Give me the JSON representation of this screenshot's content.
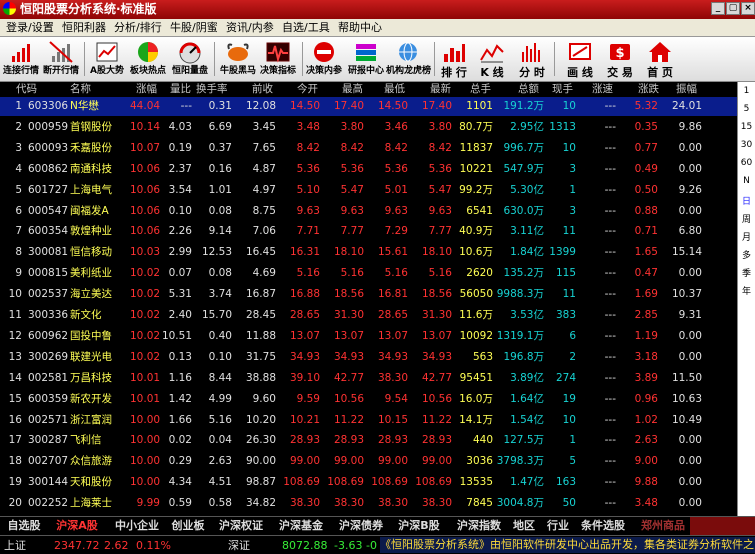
{
  "window": {
    "title": "恒阳股票分析系统·标准版",
    "min_label": "_",
    "max_label": "▢",
    "close_label": "×"
  },
  "menu": [
    "登录/设置",
    "恒阳利器",
    "分析/排行",
    "牛股/阴蜜",
    "资讯/内参",
    "自选/工具",
    "帮助中心"
  ],
  "toolbar": [
    {
      "label": "连接行情",
      "icon": "signal-icon"
    },
    {
      "label": "断开行情",
      "icon": "disconnect-icon"
    },
    {
      "label": "A股大势",
      "icon": "book-chart-icon"
    },
    {
      "label": "板块热点",
      "icon": "pie-chart-icon"
    },
    {
      "label": "恒阳量盘",
      "icon": "gauge-icon"
    },
    {
      "label": "牛股黑马",
      "icon": "bull-icon"
    },
    {
      "label": "决策指标",
      "icon": "heartbeat-icon"
    },
    {
      "label": "决策内参",
      "icon": "no-entry-icon"
    },
    {
      "label": "研报中心",
      "icon": "stacked-books-icon"
    },
    {
      "label": "机构龙虎榜",
      "icon": "globe-people-icon"
    },
    {
      "label": "排 行",
      "icon": "bar-ranking-icon"
    },
    {
      "label": "K 线",
      "icon": "k-line-icon"
    },
    {
      "label": "分 时",
      "icon": "tick-bars-icon"
    },
    {
      "label": "画 线",
      "icon": "draw-line-icon"
    },
    {
      "label": "交 易",
      "icon": "trade-icon"
    },
    {
      "label": "首 页",
      "icon": "home-icon"
    }
  ],
  "table": {
    "columns": [
      "",
      "代码",
      "名称",
      "涨幅",
      "量比",
      "换手率",
      "前收",
      "今开",
      "最高",
      "最低",
      "最新",
      "总手",
      "总额",
      "现手",
      "涨速",
      "涨跌",
      "振幅"
    ],
    "rows": [
      [
        "1",
        "603306",
        "N华懋",
        "44.04",
        "---",
        "0.31",
        "12.08",
        "14.50",
        "17.40",
        "14.50",
        "17.40",
        "1101",
        "191.2万",
        "10",
        "---",
        "5.32",
        "24.01"
      ],
      [
        "2",
        "000959",
        "首钢股份",
        "10.14",
        "4.03",
        "6.69",
        "3.45",
        "3.48",
        "3.80",
        "3.46",
        "3.80",
        "80.7万",
        "2.95亿",
        "1313",
        "---",
        "0.35",
        "9.86"
      ],
      [
        "3",
        "600093",
        "禾嘉股份",
        "10.07",
        "0.19",
        "0.37",
        "7.65",
        "8.42",
        "8.42",
        "8.42",
        "8.42",
        "11837",
        "996.7万",
        "10",
        "---",
        "0.77",
        "0.00"
      ],
      [
        "4",
        "600862",
        "南通科技",
        "10.06",
        "2.37",
        "0.16",
        "4.87",
        "5.36",
        "5.36",
        "5.36",
        "5.36",
        "10221",
        "547.9万",
        "3",
        "---",
        "0.49",
        "0.00"
      ],
      [
        "5",
        "601727",
        "上海电气",
        "10.06",
        "3.54",
        "1.01",
        "4.97",
        "5.10",
        "5.47",
        "5.01",
        "5.47",
        "99.2万",
        "5.30亿",
        "1",
        "---",
        "0.50",
        "9.26"
      ],
      [
        "6",
        "000547",
        "闽福发A",
        "10.06",
        "0.10",
        "0.08",
        "8.75",
        "9.63",
        "9.63",
        "9.63",
        "9.63",
        "6541",
        "630.0万",
        "3",
        "---",
        "0.88",
        "0.00"
      ],
      [
        "7",
        "600354",
        "敦煌种业",
        "10.06",
        "2.26",
        "9.14",
        "7.06",
        "7.71",
        "7.77",
        "7.29",
        "7.77",
        "40.9万",
        "3.11亿",
        "11",
        "---",
        "0.71",
        "6.80"
      ],
      [
        "8",
        "300081",
        "恒信移动",
        "10.03",
        "2.99",
        "12.53",
        "16.45",
        "16.31",
        "18.10",
        "15.61",
        "18.10",
        "10.6万",
        "1.84亿",
        "1399",
        "---",
        "1.65",
        "15.14"
      ],
      [
        "9",
        "000815",
        "美利纸业",
        "10.02",
        "0.07",
        "0.08",
        "4.69",
        "5.16",
        "5.16",
        "5.16",
        "5.16",
        "2620",
        "135.2万",
        "115",
        "---",
        "0.47",
        "0.00"
      ],
      [
        "10",
        "002537",
        "海立美达",
        "10.02",
        "5.31",
        "3.74",
        "16.87",
        "16.88",
        "18.56",
        "16.81",
        "18.56",
        "56050",
        "9988.3万",
        "11",
        "---",
        "1.69",
        "10.37"
      ],
      [
        "11",
        "300336",
        "新文化",
        "10.02",
        "2.40",
        "15.70",
        "28.45",
        "28.65",
        "31.30",
        "28.65",
        "31.30",
        "11.6万",
        "3.53亿",
        "383",
        "---",
        "2.85",
        "9.31"
      ],
      [
        "12",
        "600962",
        "国投中鲁",
        "10.02",
        "10.51",
        "0.40",
        "11.88",
        "13.07",
        "13.07",
        "13.07",
        "13.07",
        "10092",
        "1319.1万",
        "6",
        "---",
        "1.19",
        "0.00"
      ],
      [
        "13",
        "300269",
        "联建光电",
        "10.02",
        "0.13",
        "0.10",
        "31.75",
        "34.93",
        "34.93",
        "34.93",
        "34.93",
        "563",
        "196.8万",
        "2",
        "---",
        "3.18",
        "0.00"
      ],
      [
        "14",
        "002581",
        "万昌科技",
        "10.01",
        "1.16",
        "8.44",
        "38.88",
        "39.10",
        "42.77",
        "38.30",
        "42.77",
        "95451",
        "3.89亿",
        "274",
        "---",
        "3.89",
        "11.50"
      ],
      [
        "15",
        "600359",
        "新农开发",
        "10.01",
        "1.42",
        "4.99",
        "9.60",
        "9.59",
        "10.56",
        "9.54",
        "10.56",
        "16.0万",
        "1.64亿",
        "19",
        "---",
        "0.96",
        "10.63"
      ],
      [
        "16",
        "002571",
        "浙江富润",
        "10.00",
        "1.66",
        "5.16",
        "10.20",
        "10.21",
        "11.22",
        "10.15",
        "11.22",
        "14.1万",
        "1.54亿",
        "10",
        "---",
        "1.02",
        "10.49"
      ],
      [
        "17",
        "300287",
        "飞利信",
        "10.00",
        "0.02",
        "0.04",
        "26.30",
        "28.93",
        "28.93",
        "28.93",
        "28.93",
        "440",
        "127.5万",
        "1",
        "---",
        "2.63",
        "0.00"
      ],
      [
        "18",
        "002707",
        "众信旅游",
        "10.00",
        "0.29",
        "2.63",
        "90.00",
        "99.00",
        "99.00",
        "99.00",
        "99.00",
        "3036",
        "3798.3万",
        "5",
        "---",
        "9.00",
        "0.00"
      ],
      [
        "19",
        "300144",
        "天和股份",
        "10.00",
        "4.34",
        "4.51",
        "98.87",
        "108.69",
        "108.69",
        "108.69",
        "108.69",
        "13535",
        "1.47亿",
        "163",
        "---",
        "9.88",
        "0.00"
      ],
      [
        "20",
        "002252",
        "上海莱士",
        "9.99",
        "0.59",
        "0.58",
        "34.82",
        "38.30",
        "38.30",
        "38.30",
        "38.30",
        "7845",
        "3004.8万",
        "50",
        "---",
        "3.48",
        "0.00"
      ]
    ]
  },
  "sidebar": [
    "1",
    "5",
    "15",
    "30",
    "60",
    "N",
    "日",
    "周",
    "月",
    "多",
    "季",
    "年"
  ],
  "tabs": [
    "自选股",
    "沪深A股",
    "中小企业",
    "创业板",
    "沪深权证",
    "沪深基金",
    "沪深债券",
    "沪深B股",
    "沪深指数",
    "地区",
    "行业",
    "条件选股",
    "郑州商品"
  ],
  "status": {
    "sh_label": "上证",
    "sh_value": "2347.72",
    "sh_change": "2.62",
    "sh_pct": "0.11%",
    "sz_label": "深证",
    "sz_value": "8072.88",
    "sz_change": "-3.63",
    "sz_pct": "-0",
    "ticker": "《恒阳股票分析系统》由恒阳软件研发中心出品开发，集各类证券分析软件之"
  },
  "colors": {
    "up": "#ff3232",
    "cyan": "#17d3d3",
    "yellow": "#ffff55",
    "selected_row": "#0a1d8c"
  }
}
